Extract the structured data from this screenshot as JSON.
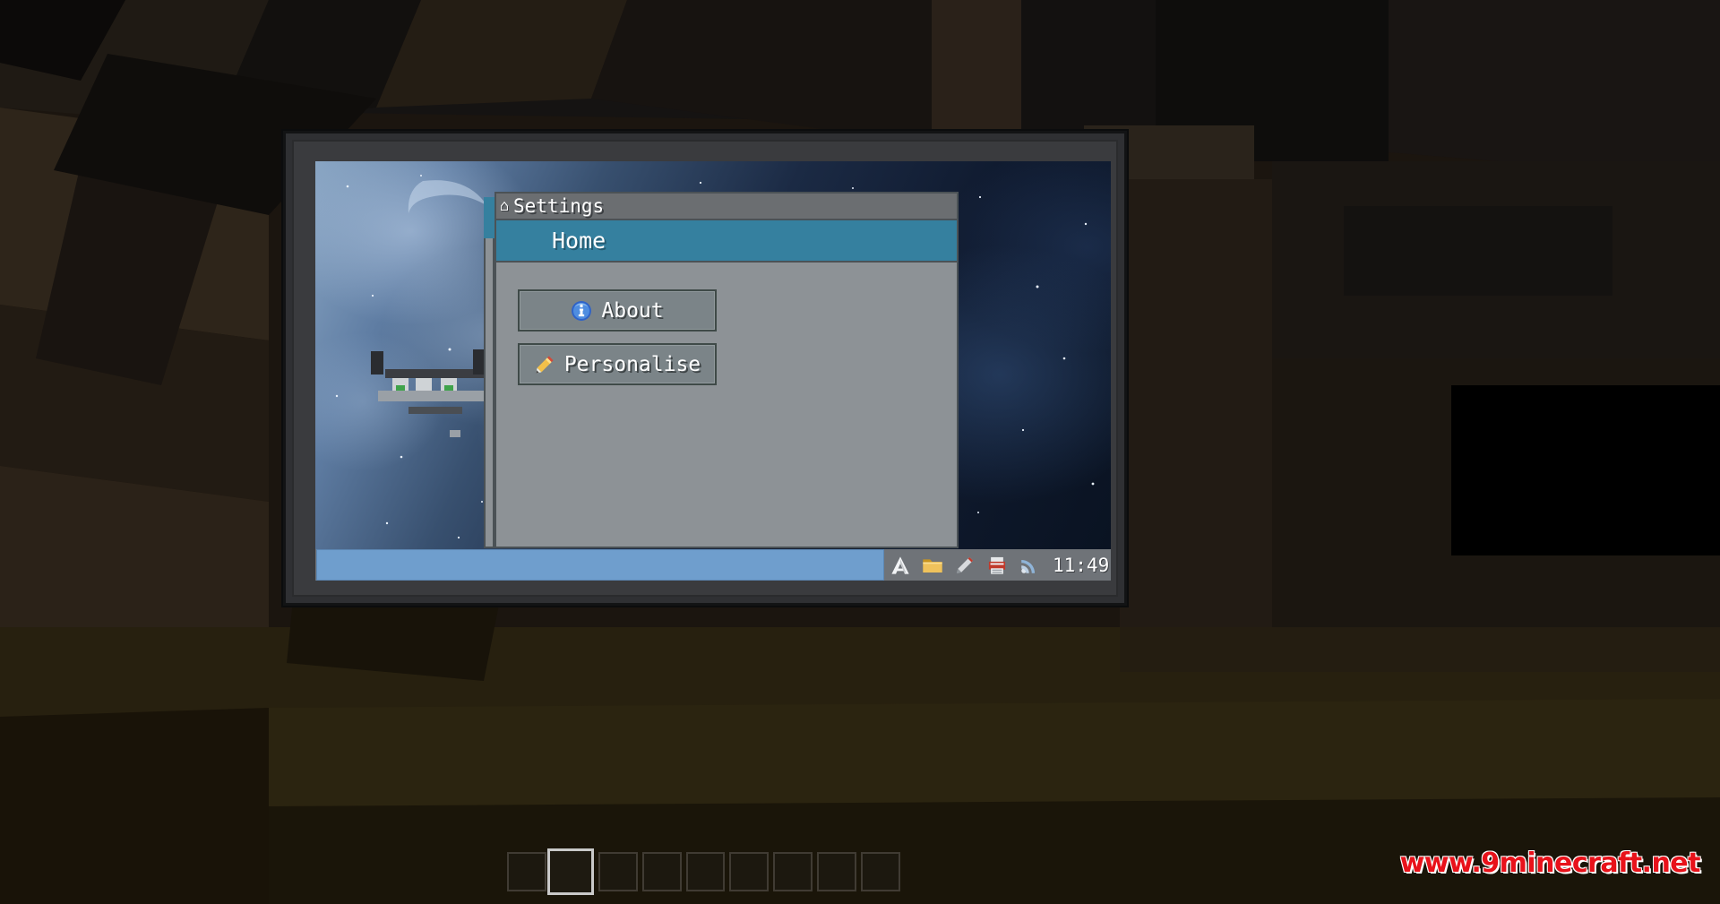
{
  "window": {
    "title": "Settings",
    "title_icon_glyph": "⌂",
    "close_label": "",
    "header": {
      "label": "Home"
    },
    "menu_items": [
      {
        "label": "About",
        "icon": "info-icon"
      },
      {
        "label": "Personalise",
        "icon": "pencil-icon"
      }
    ]
  },
  "taskbar": {
    "active_window_label": "",
    "tray_icons": [
      {
        "name": "letter-a-icon",
        "glyph": "A"
      },
      {
        "name": "folder-icon",
        "glyph": "■"
      },
      {
        "name": "wrench-icon",
        "glyph": "╱"
      },
      {
        "name": "printer-icon",
        "glyph": "▣"
      },
      {
        "name": "rss-icon",
        "glyph": "◠"
      }
    ],
    "clock": "11:49"
  },
  "watermark": {
    "text": "www.9minecraft.net"
  },
  "colors": {
    "header_teal": "#35809f",
    "window_gray": "#8d9296",
    "titlebar_gray": "#6b6e71",
    "button_gray": "#7b8488",
    "taskbar_gray": "#6f7378",
    "taskbar_active": "#6f9ecd",
    "border_dark": "#4b5256",
    "text_white": "#ffffff",
    "watermark_red": "#e8121a"
  },
  "hotbar": {
    "slot_count": 9,
    "selected_index": 1
  }
}
